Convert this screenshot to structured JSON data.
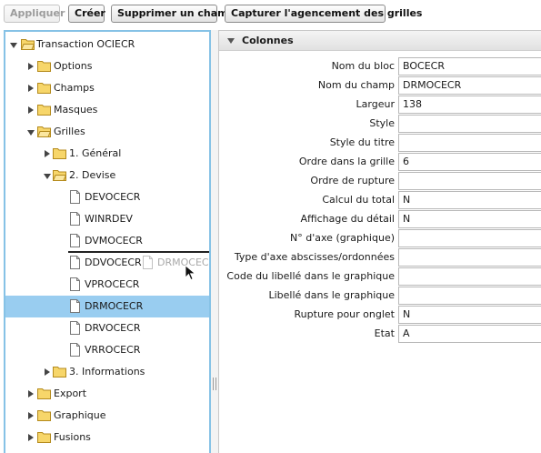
{
  "toolbar": {
    "apply_label": "Appliquer",
    "create_label": "Créer",
    "delete_field_label": "Supprimer un champ",
    "capture_layout_label": "Capturer l'agencement des grilles"
  },
  "tree": {
    "root": "Transaction OCIECR",
    "options": "Options",
    "champs": "Champs",
    "masques": "Masques",
    "grilles": "Grilles",
    "general": "1. Général",
    "devise": "2. Devise",
    "devise_items": [
      "DEVOCECR",
      "WINRDEV",
      "DVMOCECR",
      "DDVOCECR",
      "VPROCECR",
      "DRMOCECR",
      "DRVOCECR",
      "VRROCECR"
    ],
    "informations": "3. Informations",
    "export": "Export",
    "graphique": "Graphique",
    "fusions": "Fusions",
    "drag_ghost": "DRMOCECR"
  },
  "props": {
    "section_title": "Colonnes",
    "rows": [
      {
        "label": "Nom du bloc",
        "value": "BOCECR"
      },
      {
        "label": "Nom du champ",
        "value": "DRMOCECR"
      },
      {
        "label": "Largeur",
        "value": "138"
      },
      {
        "label": "Style",
        "value": ""
      },
      {
        "label": "Style du titre",
        "value": ""
      },
      {
        "label": "Ordre dans la grille",
        "value": "6"
      },
      {
        "label": "Ordre de rupture",
        "value": ""
      },
      {
        "label": "Calcul du total",
        "value": "N"
      },
      {
        "label": "Affichage du détail",
        "value": "N"
      },
      {
        "label": "N° d'axe (graphique)",
        "value": ""
      },
      {
        "label": "Type d'axe abscisses/ordonnées",
        "value": ""
      },
      {
        "label": "Code du libellé dans le graphique",
        "value": ""
      },
      {
        "label": "Libellé dans le graphique",
        "value": ""
      },
      {
        "label": "Rupture pour onglet",
        "value": "N"
      },
      {
        "label": "Etat",
        "value": "A"
      }
    ]
  },
  "colors": {
    "selection": "#99cdf0",
    "panel_border": "#86c2e6",
    "folder": "#f2c94c"
  }
}
